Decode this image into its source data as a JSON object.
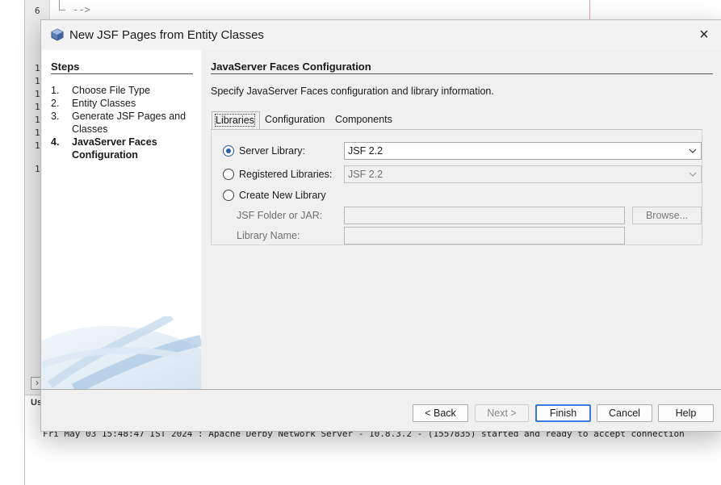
{
  "ide": {
    "gutter_numbers": [
      "6",
      "1",
      "1",
      "1",
      "1",
      "1",
      "1",
      "1",
      "1"
    ],
    "code_line": "-->",
    "output_tab_label": "Us",
    "console_line": "Fri May 03 15:48:47 IST 2024 : Apache Derby Network Server - 10.8.3.2 - (1557835) started and ready to accept connection"
  },
  "dialog": {
    "title": "New JSF Pages from Entity Classes",
    "close_label": "×",
    "steps": {
      "title": "Steps",
      "items": [
        {
          "num": "1.",
          "label": "Choose File Type"
        },
        {
          "num": "2.",
          "label": "Entity Classes"
        },
        {
          "num": "3.",
          "label": "Generate JSF Pages and Classes"
        },
        {
          "num": "4.",
          "label": "JavaServer Faces Configuration"
        }
      ],
      "current_index": 3
    },
    "panel": {
      "title": "JavaServer Faces Configuration",
      "description": "Specify JavaServer Faces configuration and library information.",
      "tabs": [
        "Libraries",
        "Configuration",
        "Components"
      ],
      "active_tab": "Libraries"
    },
    "libraries": {
      "server_library_label": "Server Library:",
      "server_library_value": "JSF 2.2",
      "registered_libraries_label": "Registered Libraries:",
      "registered_libraries_value": "JSF 2.2",
      "create_new_label": "Create New Library",
      "jsf_folder_label": "JSF Folder or JAR:",
      "library_name_label": "Library Name:",
      "browse_label": "Browse...",
      "selected_option": "Server Library"
    },
    "buttons": {
      "back": "< Back",
      "next": "Next >",
      "finish": "Finish",
      "cancel": "Cancel",
      "help": "Help"
    }
  },
  "colors": {
    "accent": "#2a5ea8",
    "default_button_border": "#3b7ad6"
  }
}
